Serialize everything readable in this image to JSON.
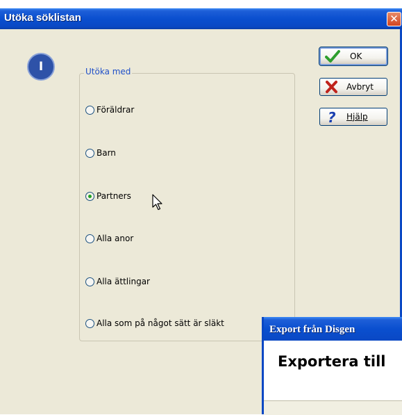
{
  "dialog": {
    "title": "Utöka söklistan",
    "close_glyph": "✕",
    "info_badge_text": "I",
    "group_label": "Utöka med",
    "options": [
      {
        "label": "Föräldrar",
        "checked": false
      },
      {
        "label": "Barn",
        "checked": false
      },
      {
        "label": "Partners",
        "checked": true
      },
      {
        "label": "Alla anor",
        "checked": false
      },
      {
        "label": "Alla ättlingar",
        "checked": false
      },
      {
        "label": "Alla som på något sätt är släkt",
        "checked": false
      }
    ],
    "buttons": {
      "ok": {
        "label": "OK",
        "icon": "checkmark-icon",
        "color": "#2e9e2e"
      },
      "cancel": {
        "label": "Avbryt",
        "icon": "x-mark-icon",
        "color": "#c0231c"
      },
      "help": {
        "label": "Hjälp",
        "icon": "question-mark-icon",
        "color": "#1a3fb0"
      }
    }
  },
  "second_window": {
    "title": "Export från Disgen",
    "heading": "Exportera till"
  },
  "colors": {
    "xp_titlebar_blue": "#0a48c4",
    "dialog_bg": "#ece9d8",
    "group_label_blue": "#1f4fc8",
    "close_red": "#d2441f"
  }
}
